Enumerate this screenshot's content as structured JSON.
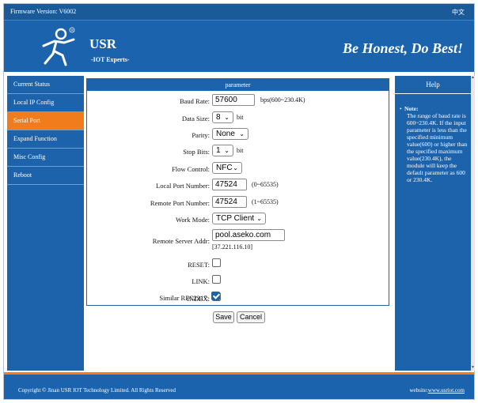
{
  "topbar": {
    "firmware": "Firmware Version: V6002",
    "language": "中文"
  },
  "header": {
    "brand": "USR",
    "brand_sub": "-IOT Experts-",
    "slogan": "Be Honest, Do Best!",
    "logo_icon": "usr-runner-logo"
  },
  "sidebar": {
    "items": [
      {
        "label": "Current Status",
        "active": false
      },
      {
        "label": "Local IP Config",
        "active": false
      },
      {
        "label": "Serial Port",
        "active": true
      },
      {
        "label": "Expand Function",
        "active": false
      },
      {
        "label": "Misc Config",
        "active": false
      },
      {
        "label": "Reboot",
        "active": false
      }
    ]
  },
  "panel": {
    "title": "parameter"
  },
  "form": {
    "baud_rate": {
      "label": "Baud Rate:",
      "value": "57600",
      "unit": "bps(600~230.4K)"
    },
    "data_size": {
      "label": "Data Size:",
      "value": "8",
      "unit": "bit"
    },
    "parity": {
      "label": "Parity:",
      "value": "None"
    },
    "stop_bits": {
      "label": "Stop Bits:",
      "value": "1",
      "unit": "bit"
    },
    "flow_control": {
      "label": "Flow Control:",
      "value": "NFC"
    },
    "local_port": {
      "label": "Local Port Number:",
      "value": "47524",
      "unit": "(0~65535)"
    },
    "remote_port": {
      "label": "Remote Port Number:",
      "value": "47524",
      "unit": "(1~65535)"
    },
    "work_mode": {
      "label": "Work Mode:",
      "value": "TCP Client"
    },
    "remote_server": {
      "label": "Remote Server Addr:",
      "value": "pool.aseko.com",
      "resolved": "[37.221.116.10]"
    },
    "reset": {
      "label": "RESET:",
      "checked": false
    },
    "link": {
      "label": "LINK:",
      "checked": false
    },
    "index": {
      "label": "INDEX:",
      "checked": false
    },
    "rfc2217": {
      "label": "Similar RFC2217:",
      "checked": true
    }
  },
  "buttons": {
    "save": "Save",
    "cancel": "Cancel"
  },
  "help": {
    "title": "Help",
    "note_label": "Note:",
    "note_text": "The range of baud rate is 600~230.4K. If the input parameter is less than the specified minimum value(600) or higher than the specified maximum value(230.4K), the module will keep the default parameter as 600 or 230.4K."
  },
  "footer": {
    "copyright": "Copyright © Jinan USR IOT Technology Limited. All Rights Reserved",
    "website_label": "website:",
    "website_link": "www.usriot.com"
  }
}
